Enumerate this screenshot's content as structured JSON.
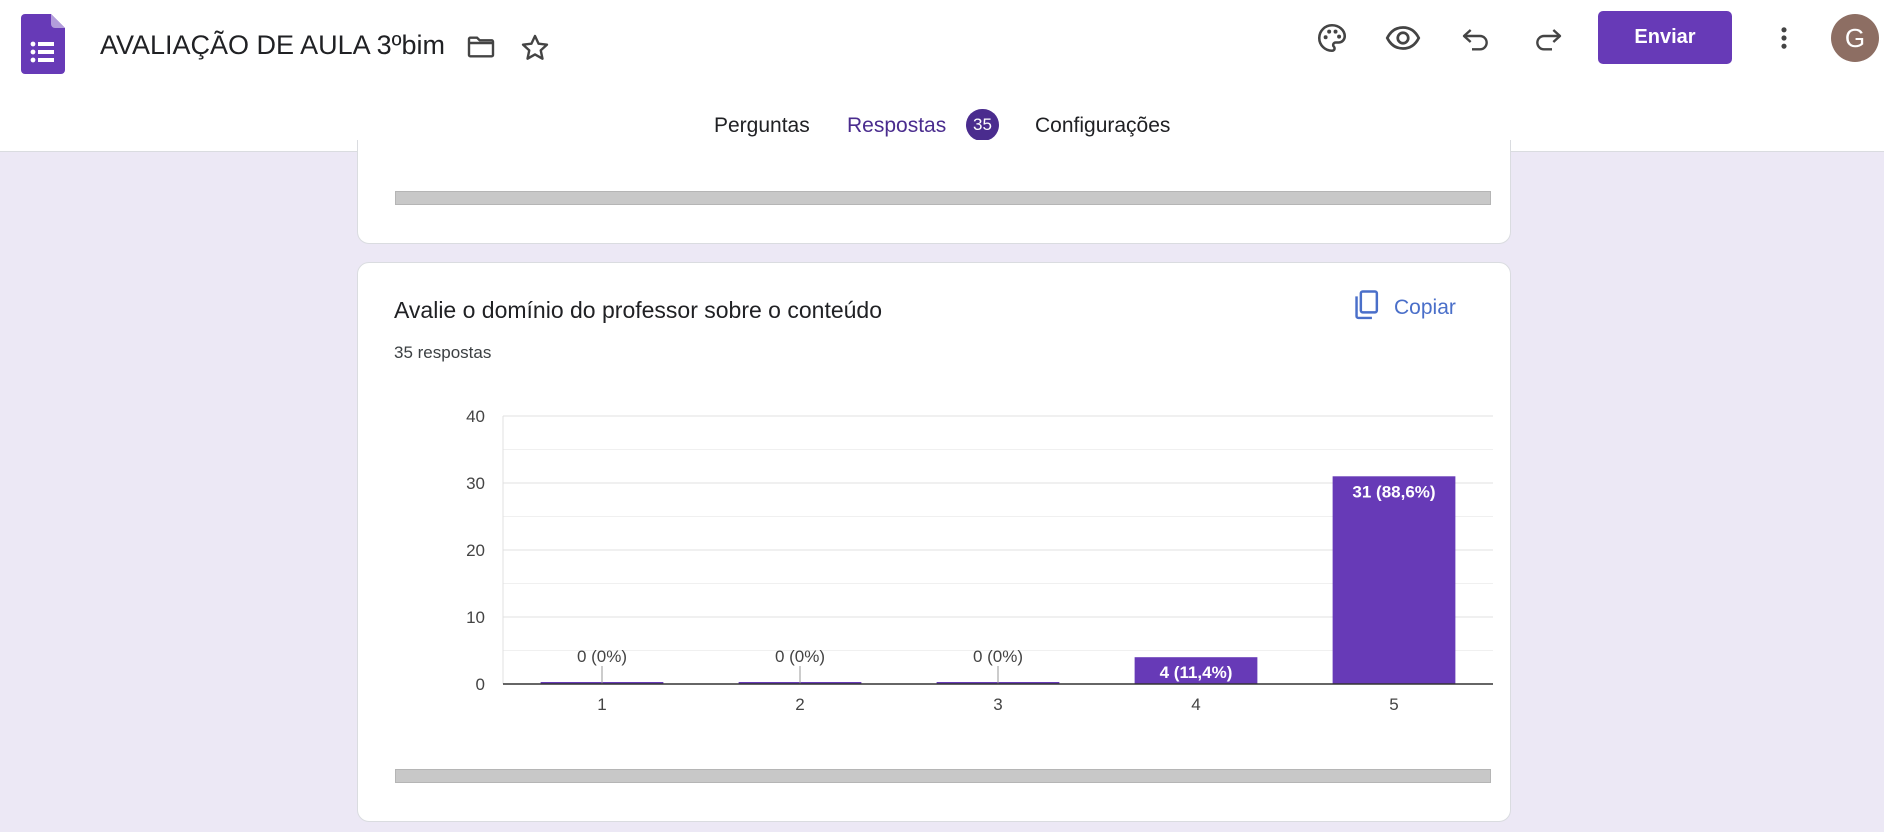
{
  "header": {
    "title": "AVALIAÇÃO DE AULA 3ºbim",
    "send_label": "Enviar",
    "avatar_letter": "G",
    "icons": [
      "forms-logo-icon",
      "folder-icon",
      "star-icon",
      "palette-icon",
      "eye-icon",
      "undo-icon",
      "redo-icon",
      "more-vert-icon"
    ]
  },
  "tabs": {
    "questions": "Perguntas",
    "responses": "Respostas",
    "responses_count": "35",
    "settings": "Configurações",
    "active": "Respostas"
  },
  "question": {
    "title": "Avalie o domínio do professor sobre o conteúdo",
    "response_count": "35 respostas",
    "copy_label": "Copiar"
  },
  "colors": {
    "accent": "#673ab7",
    "tab_active": "#4a2c8e",
    "copy_blue": "#4a6fc9",
    "background": "#ece8f5"
  },
  "chart_data": {
    "type": "bar",
    "categories": [
      "1",
      "2",
      "3",
      "4",
      "5"
    ],
    "values": [
      0,
      0,
      0,
      4,
      31
    ],
    "labels": [
      "0 (0%)",
      "0 (0%)",
      "0 (0%)",
      "4 (11,4%)",
      "31 (88,6%)"
    ],
    "ylim": [
      0,
      40
    ],
    "yticks": [
      0,
      10,
      20,
      30,
      40
    ],
    "grid": true,
    "bar_color": "#673ab7"
  }
}
